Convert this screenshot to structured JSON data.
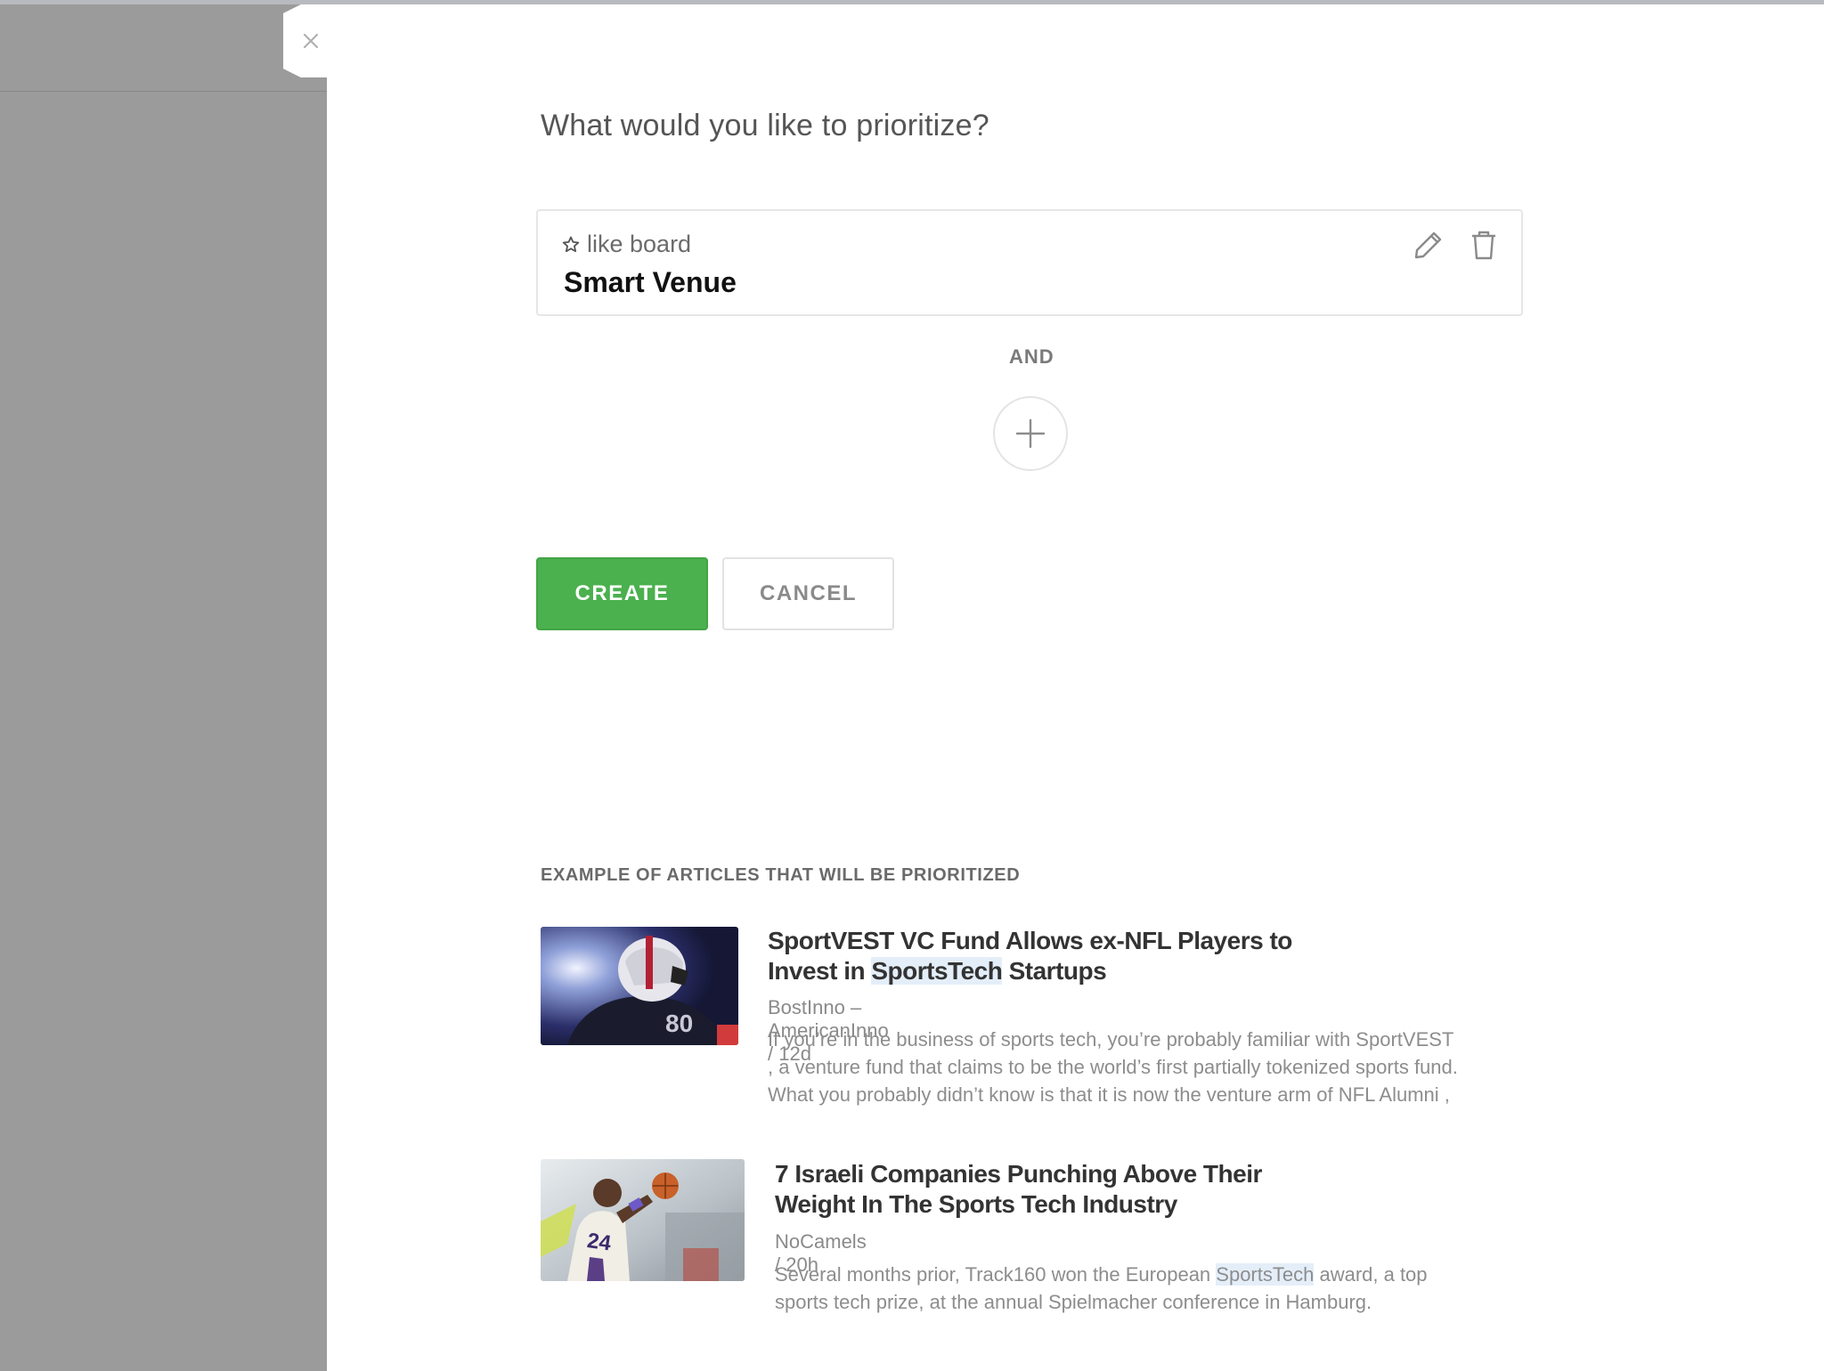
{
  "dialog": {
    "heading": "What would you like to prioritize?",
    "rule": {
      "type_label": "like board",
      "value": "Smart Venue"
    },
    "connector": "AND",
    "buttons": {
      "create": "CREATE",
      "cancel": "CANCEL"
    }
  },
  "examples": {
    "title": "EXAMPLE OF ARTICLES THAT WILL BE PRIORITIZED",
    "articles": [
      {
        "title_before": "SportVEST VC Fund Allows ex-NFL Players to",
        "title_line2_before": "Invest in ",
        "title_highlight": "SportsTech",
        "title_after": " Startups",
        "meta": "BostInno – AmericanInno / 12d",
        "snippet_1": "If you’re in the business of sports tech, you’re probably familiar with SportVEST",
        "snippet_2": ", a venture fund that claims to be the world’s first partially tokenized sports fund.",
        "snippet_3": "What you probably didn’t know is that it is now the venture arm of NFL Alumni ,",
        "thumb_number": "80"
      },
      {
        "title_line1": "7 Israeli Companies Punching Above Their",
        "title_line2": "Weight In The Sports Tech Industry",
        "meta": "NoCamels / 20h",
        "snippet_before": "Several months prior, Track160 won the European ",
        "snippet_highlight": "SportsTech",
        "snippet_after": " award, a top",
        "snippet_2": "sports tech prize, at the annual Spielmacher conference in Hamburg.",
        "thumb_number": "24"
      }
    ]
  },
  "colors": {
    "accent_green": "#4bb04e",
    "highlight": "#e4eef9",
    "overlay_gray": "#9b9b9b"
  },
  "icons": [
    "close-icon",
    "star-icon",
    "pencil-icon",
    "trash-icon",
    "plus-icon"
  ]
}
